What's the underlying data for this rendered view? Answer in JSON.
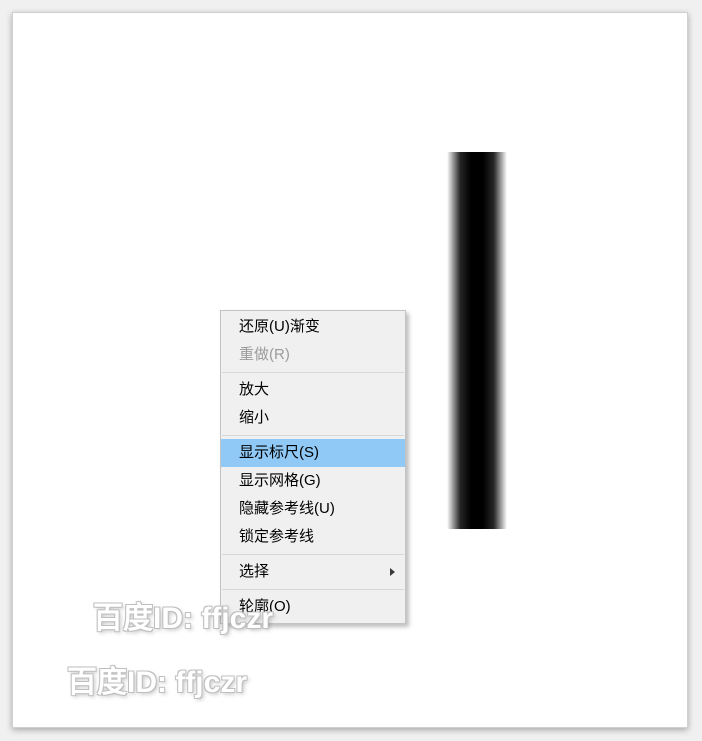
{
  "menu": {
    "undo": "还原(U)渐变",
    "redo": "重做(R)",
    "zoom_in": "放大",
    "zoom_out": "缩小",
    "show_ruler": "显示标尺(S)",
    "show_grid": "显示网格(G)",
    "hide_guides": "隐藏参考线(U)",
    "lock_guides": "锁定参考线",
    "select": "选择",
    "outline": "轮廓(O)"
  },
  "watermark": {
    "line1": "百度ID: ffjczr",
    "line2": "百度ID: ffjczr"
  }
}
